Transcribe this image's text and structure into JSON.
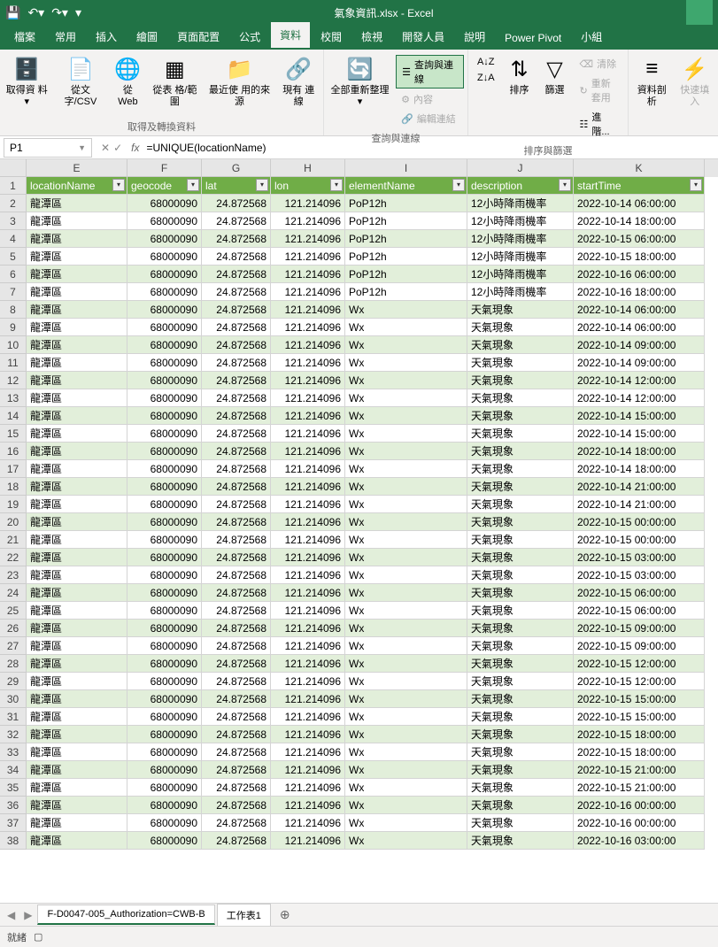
{
  "app": {
    "title": "氣象資訊.xlsx - Excel"
  },
  "tabs": [
    "檔案",
    "常用",
    "插入",
    "繪圖",
    "頁面配置",
    "公式",
    "資料",
    "校閱",
    "檢視",
    "開發人員",
    "說明",
    "Power Pivot",
    "小組"
  ],
  "active_tab": "資料",
  "ribbon": {
    "group1_label": "取得及轉換資料",
    "get_data": "取得資\n料▾",
    "from_text": "從文\n字/CSV",
    "from_web": "從\nWeb",
    "from_table": "從表\n格/範圍",
    "recent": "最近使\n用的來源",
    "existing": "現有\n連線",
    "group2_label": "查詢與連線",
    "refresh_all": "全部重新整理\n▾",
    "queries": "查詢與連線",
    "properties": "內容",
    "edit_links": "編輯連結",
    "group3_label": "排序與篩選",
    "sort_az": "A↓Z",
    "sort_za": "Z↓A",
    "sort": "排序",
    "filter": "篩選",
    "clear": "清除",
    "reapply": "重新套用",
    "advanced": "進階...",
    "group4_label": "",
    "text_to_cols": "資料剖析",
    "flash_fill": "快速填入"
  },
  "name_box": "P1",
  "formula": "=UNIQUE(locationName)",
  "columns": [
    "E",
    "F",
    "G",
    "H",
    "I",
    "J",
    "K"
  ],
  "headers": [
    "locationName",
    "geocode",
    "lat",
    "lon",
    "elementName",
    "description",
    "startTime"
  ],
  "rows": [
    {
      "n": 2,
      "band": 0,
      "d": [
        "龍潭區",
        "68000090",
        "24.872568",
        "121.214096",
        "PoP12h",
        "12小時降雨機率",
        "2022-10-14 06:00:00"
      ]
    },
    {
      "n": 3,
      "band": 1,
      "d": [
        "龍潭區",
        "68000090",
        "24.872568",
        "121.214096",
        "PoP12h",
        "12小時降雨機率",
        "2022-10-14 18:00:00"
      ]
    },
    {
      "n": 4,
      "band": 0,
      "d": [
        "龍潭區",
        "68000090",
        "24.872568",
        "121.214096",
        "PoP12h",
        "12小時降雨機率",
        "2022-10-15 06:00:00"
      ]
    },
    {
      "n": 5,
      "band": 1,
      "d": [
        "龍潭區",
        "68000090",
        "24.872568",
        "121.214096",
        "PoP12h",
        "12小時降雨機率",
        "2022-10-15 18:00:00"
      ]
    },
    {
      "n": 6,
      "band": 0,
      "d": [
        "龍潭區",
        "68000090",
        "24.872568",
        "121.214096",
        "PoP12h",
        "12小時降雨機率",
        "2022-10-16 06:00:00"
      ]
    },
    {
      "n": 7,
      "band": 1,
      "d": [
        "龍潭區",
        "68000090",
        "24.872568",
        "121.214096",
        "PoP12h",
        "12小時降雨機率",
        "2022-10-16 18:00:00"
      ]
    },
    {
      "n": 8,
      "band": 0,
      "d": [
        "龍潭區",
        "68000090",
        "24.872568",
        "121.214096",
        "Wx",
        "天氣現象",
        "2022-10-14 06:00:00"
      ]
    },
    {
      "n": 9,
      "band": 1,
      "d": [
        "龍潭區",
        "68000090",
        "24.872568",
        "121.214096",
        "Wx",
        "天氣現象",
        "2022-10-14 06:00:00"
      ]
    },
    {
      "n": 10,
      "band": 0,
      "d": [
        "龍潭區",
        "68000090",
        "24.872568",
        "121.214096",
        "Wx",
        "天氣現象",
        "2022-10-14 09:00:00"
      ]
    },
    {
      "n": 11,
      "band": 1,
      "d": [
        "龍潭區",
        "68000090",
        "24.872568",
        "121.214096",
        "Wx",
        "天氣現象",
        "2022-10-14 09:00:00"
      ]
    },
    {
      "n": 12,
      "band": 0,
      "d": [
        "龍潭區",
        "68000090",
        "24.872568",
        "121.214096",
        "Wx",
        "天氣現象",
        "2022-10-14 12:00:00"
      ]
    },
    {
      "n": 13,
      "band": 1,
      "d": [
        "龍潭區",
        "68000090",
        "24.872568",
        "121.214096",
        "Wx",
        "天氣現象",
        "2022-10-14 12:00:00"
      ]
    },
    {
      "n": 14,
      "band": 0,
      "d": [
        "龍潭區",
        "68000090",
        "24.872568",
        "121.214096",
        "Wx",
        "天氣現象",
        "2022-10-14 15:00:00"
      ]
    },
    {
      "n": 15,
      "band": 1,
      "d": [
        "龍潭區",
        "68000090",
        "24.872568",
        "121.214096",
        "Wx",
        "天氣現象",
        "2022-10-14 15:00:00"
      ]
    },
    {
      "n": 16,
      "band": 0,
      "d": [
        "龍潭區",
        "68000090",
        "24.872568",
        "121.214096",
        "Wx",
        "天氣現象",
        "2022-10-14 18:00:00"
      ]
    },
    {
      "n": 17,
      "band": 1,
      "d": [
        "龍潭區",
        "68000090",
        "24.872568",
        "121.214096",
        "Wx",
        "天氣現象",
        "2022-10-14 18:00:00"
      ]
    },
    {
      "n": 18,
      "band": 0,
      "d": [
        "龍潭區",
        "68000090",
        "24.872568",
        "121.214096",
        "Wx",
        "天氣現象",
        "2022-10-14 21:00:00"
      ]
    },
    {
      "n": 19,
      "band": 1,
      "d": [
        "龍潭區",
        "68000090",
        "24.872568",
        "121.214096",
        "Wx",
        "天氣現象",
        "2022-10-14 21:00:00"
      ]
    },
    {
      "n": 20,
      "band": 0,
      "d": [
        "龍潭區",
        "68000090",
        "24.872568",
        "121.214096",
        "Wx",
        "天氣現象",
        "2022-10-15 00:00:00"
      ]
    },
    {
      "n": 21,
      "band": 1,
      "d": [
        "龍潭區",
        "68000090",
        "24.872568",
        "121.214096",
        "Wx",
        "天氣現象",
        "2022-10-15 00:00:00"
      ]
    },
    {
      "n": 22,
      "band": 0,
      "d": [
        "龍潭區",
        "68000090",
        "24.872568",
        "121.214096",
        "Wx",
        "天氣現象",
        "2022-10-15 03:00:00"
      ]
    },
    {
      "n": 23,
      "band": 1,
      "d": [
        "龍潭區",
        "68000090",
        "24.872568",
        "121.214096",
        "Wx",
        "天氣現象",
        "2022-10-15 03:00:00"
      ]
    },
    {
      "n": 24,
      "band": 0,
      "d": [
        "龍潭區",
        "68000090",
        "24.872568",
        "121.214096",
        "Wx",
        "天氣現象",
        "2022-10-15 06:00:00"
      ]
    },
    {
      "n": 25,
      "band": 1,
      "d": [
        "龍潭區",
        "68000090",
        "24.872568",
        "121.214096",
        "Wx",
        "天氣現象",
        "2022-10-15 06:00:00"
      ]
    },
    {
      "n": 26,
      "band": 0,
      "d": [
        "龍潭區",
        "68000090",
        "24.872568",
        "121.214096",
        "Wx",
        "天氣現象",
        "2022-10-15 09:00:00"
      ]
    },
    {
      "n": 27,
      "band": 1,
      "d": [
        "龍潭區",
        "68000090",
        "24.872568",
        "121.214096",
        "Wx",
        "天氣現象",
        "2022-10-15 09:00:00"
      ]
    },
    {
      "n": 28,
      "band": 0,
      "d": [
        "龍潭區",
        "68000090",
        "24.872568",
        "121.214096",
        "Wx",
        "天氣現象",
        "2022-10-15 12:00:00"
      ]
    },
    {
      "n": 29,
      "band": 1,
      "d": [
        "龍潭區",
        "68000090",
        "24.872568",
        "121.214096",
        "Wx",
        "天氣現象",
        "2022-10-15 12:00:00"
      ]
    },
    {
      "n": 30,
      "band": 0,
      "d": [
        "龍潭區",
        "68000090",
        "24.872568",
        "121.214096",
        "Wx",
        "天氣現象",
        "2022-10-15 15:00:00"
      ]
    },
    {
      "n": 31,
      "band": 1,
      "d": [
        "龍潭區",
        "68000090",
        "24.872568",
        "121.214096",
        "Wx",
        "天氣現象",
        "2022-10-15 15:00:00"
      ]
    },
    {
      "n": 32,
      "band": 0,
      "d": [
        "龍潭區",
        "68000090",
        "24.872568",
        "121.214096",
        "Wx",
        "天氣現象",
        "2022-10-15 18:00:00"
      ]
    },
    {
      "n": 33,
      "band": 1,
      "d": [
        "龍潭區",
        "68000090",
        "24.872568",
        "121.214096",
        "Wx",
        "天氣現象",
        "2022-10-15 18:00:00"
      ]
    },
    {
      "n": 34,
      "band": 0,
      "d": [
        "龍潭區",
        "68000090",
        "24.872568",
        "121.214096",
        "Wx",
        "天氣現象",
        "2022-10-15 21:00:00"
      ]
    },
    {
      "n": 35,
      "band": 1,
      "d": [
        "龍潭區",
        "68000090",
        "24.872568",
        "121.214096",
        "Wx",
        "天氣現象",
        "2022-10-15 21:00:00"
      ]
    },
    {
      "n": 36,
      "band": 0,
      "d": [
        "龍潭區",
        "68000090",
        "24.872568",
        "121.214096",
        "Wx",
        "天氣現象",
        "2022-10-16 00:00:00"
      ]
    },
    {
      "n": 37,
      "band": 1,
      "d": [
        "龍潭區",
        "68000090",
        "24.872568",
        "121.214096",
        "Wx",
        "天氣現象",
        "2022-10-16 00:00:00"
      ]
    },
    {
      "n": 38,
      "band": 0,
      "d": [
        "龍潭區",
        "68000090",
        "24.872568",
        "121.214096",
        "Wx",
        "天氣現象",
        "2022-10-16 03:00:00"
      ]
    }
  ],
  "sheet_tabs": [
    "F-D0047-005_Authorization=CWB-B",
    "工作表1"
  ],
  "status": "就緒"
}
